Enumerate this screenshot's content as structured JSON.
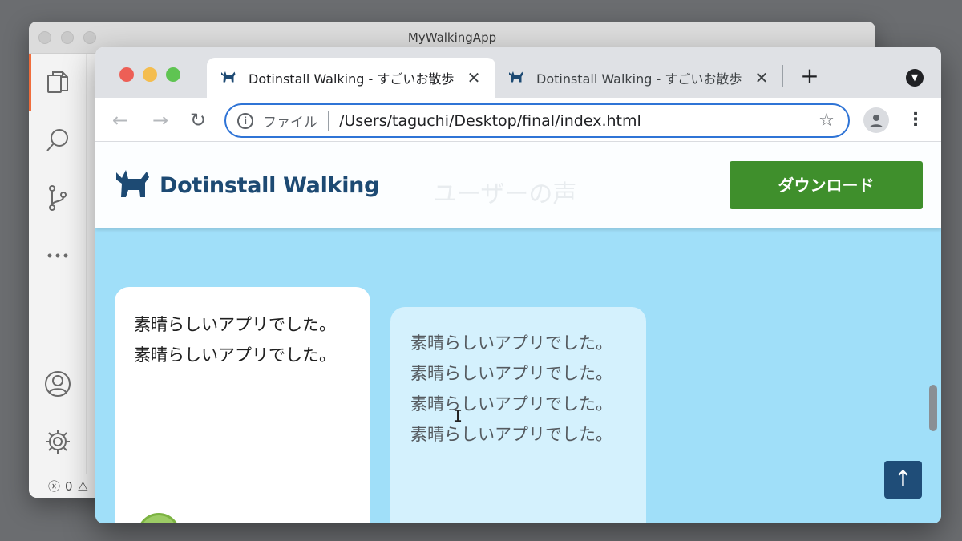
{
  "vscode": {
    "title": "MyWalkingApp",
    "status": {
      "errors": "0",
      "warnings_icon": "warning-icon"
    },
    "activity_icons": [
      "files-icon",
      "search-icon",
      "source-control-icon",
      "more-icon",
      "account-icon",
      "settings-icon"
    ]
  },
  "browser": {
    "tabs": [
      {
        "label": "Dotinstall Walking - すごいお散歩",
        "active": true
      },
      {
        "label": "Dotinstall Walking - すごいお散歩",
        "active": false
      }
    ],
    "close_glyph": "✕",
    "new_tab_glyph": "+",
    "omnibox": {
      "scheme_label": "ファイル",
      "url": "/Users/taguchi/Desktop/final/index.html"
    }
  },
  "site": {
    "logo_text": "Dotinstall Walking",
    "section_title": "ユーザーの声",
    "download_label": "ダウンロード",
    "brand_color": "#1d4a73",
    "accent_color": "#3f8f2c",
    "background_color": "#a0dff9",
    "testimonials": [
      {
        "text": "素晴らしいアプリでした。素晴らしいアプリでした。"
      },
      {
        "text": "素晴らしいアプリでした。素晴らしいアプリでした。素晴らしいアプリでした。素晴らしいアプリでした。"
      }
    ],
    "back_to_top": "↑"
  }
}
